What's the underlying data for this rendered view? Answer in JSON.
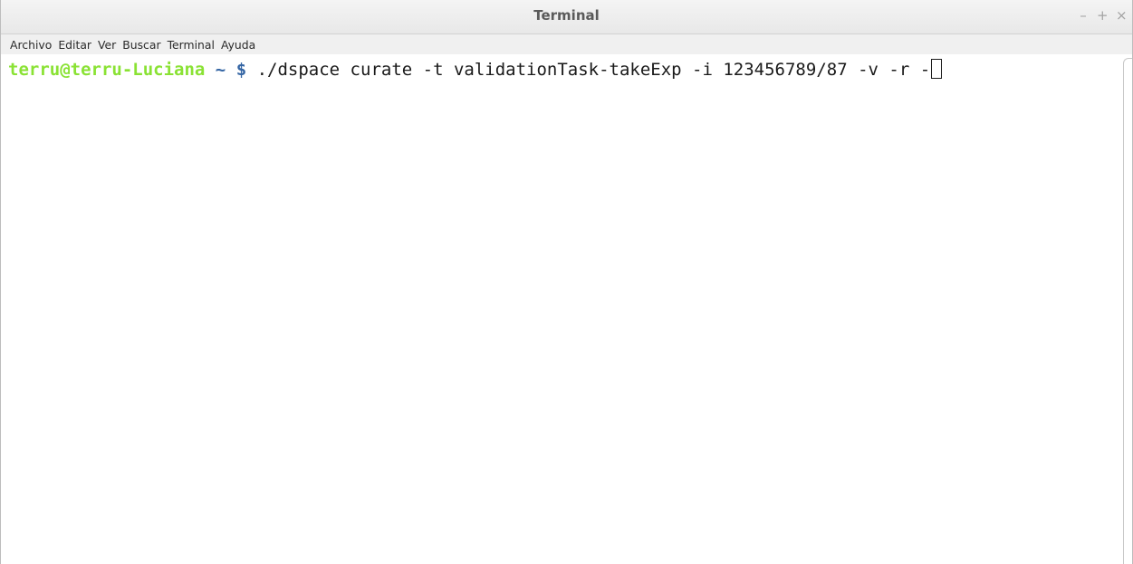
{
  "window": {
    "title": "Terminal",
    "controls": {
      "minimize": "–",
      "maximize": "+",
      "close": "×"
    }
  },
  "menubar": {
    "items": [
      "Archivo",
      "Editar",
      "Ver",
      "Buscar",
      "Terminal",
      "Ayuda"
    ]
  },
  "terminal": {
    "prompt_user_host": "terru@terru-Luciana",
    "prompt_path": "~",
    "prompt_symbol": "$",
    "command": "./dspace curate -t validationTask-takeExp -i 123456789/87 -v -r -"
  },
  "colors": {
    "prompt_user_host": "#8ae234",
    "prompt_path": "#3465a4",
    "command_text": "#1a1a1a",
    "background": "#ffffff"
  }
}
